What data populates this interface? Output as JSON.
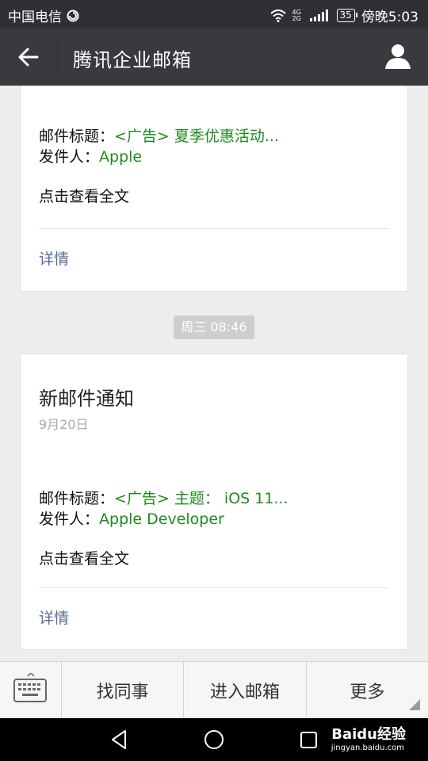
{
  "status_bar": {
    "carrier": "中国电信",
    "network": "4G 2G",
    "battery": "35",
    "time": "傍晚5:03"
  },
  "header": {
    "title": "腾讯企业邮箱"
  },
  "messages": [
    {
      "subject_label": "邮件标题：",
      "subject": "<广告> 夏季优惠活动...",
      "sender_label": "发件人：",
      "sender": "Apple",
      "action": "点击查看全文",
      "details": "详情"
    },
    {
      "title": "新邮件通知",
      "date": "9月20日",
      "subject_label": "邮件标题：",
      "subject": "<广告> 主题： iOS 11...",
      "sender_label": "发件人：",
      "sender": "Apple Developer",
      "action": "点击查看全文",
      "details": "详情"
    }
  ],
  "timestamp": "周三 08:46",
  "toolbar": {
    "find_colleague": "找同事",
    "enter_mailbox": "进入邮箱",
    "more": "更多"
  },
  "watermark": {
    "text": "Baidu经验",
    "url": "jingyan.baidu.com"
  },
  "colors": {
    "header_bg": "#393a3f",
    "status_bg": "#2f3034",
    "highlight_green": "#1f8a1f",
    "link_blue": "#586c94"
  },
  "icons": [
    "back-arrow-icon",
    "profile-icon",
    "keyboard-icon",
    "nav-back-icon",
    "nav-home-icon",
    "nav-recents-icon",
    "wifi-icon",
    "signal-icon"
  ]
}
